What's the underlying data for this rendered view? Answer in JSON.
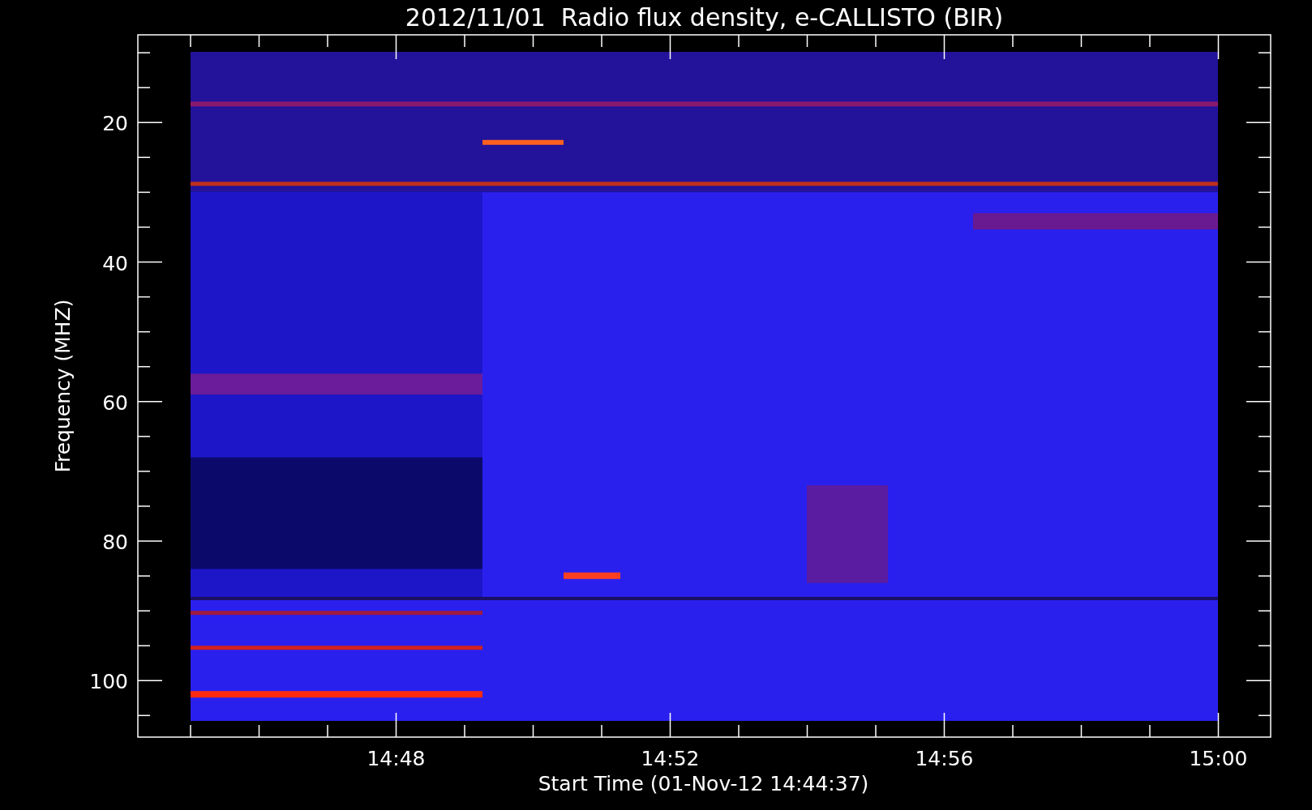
{
  "title": "2012/11/01  Radio flux density, e-CALLISTO (BIR)",
  "y_axis": {
    "label": "Frequency (MHZ)",
    "ticks": [
      "20",
      "40",
      "60",
      "80",
      "100"
    ]
  },
  "x_axis": {
    "label": "Start Time (01-Nov-12 14:44:37)",
    "ticks": [
      "14:48",
      "14:52",
      "14:56",
      "15:00"
    ]
  }
}
